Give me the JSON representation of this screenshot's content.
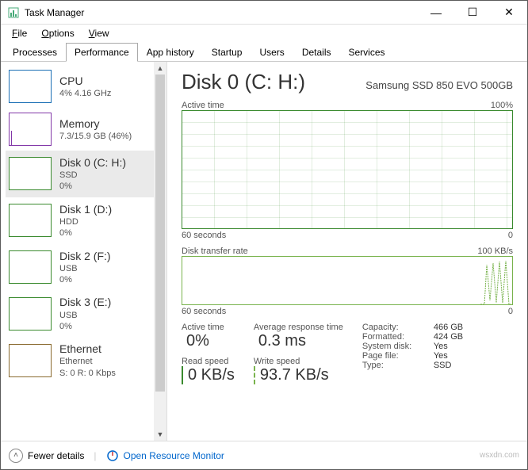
{
  "window": {
    "title": "Task Manager"
  },
  "menu": {
    "file": "File",
    "options": "Options",
    "view": "View"
  },
  "tabs": {
    "processes": "Processes",
    "performance": "Performance",
    "app_history": "App history",
    "startup": "Startup",
    "users": "Users",
    "details": "Details",
    "services": "Services"
  },
  "sidebar": {
    "items": [
      {
        "name": "CPU",
        "sub": "4% 4.16 GHz"
      },
      {
        "name": "Memory",
        "sub": "7.3/15.9 GB (46%)"
      },
      {
        "name": "Disk 0 (C: H:)",
        "sub": "SSD",
        "sub2": "0%"
      },
      {
        "name": "Disk 1 (D:)",
        "sub": "HDD",
        "sub2": "0%"
      },
      {
        "name": "Disk 2 (F:)",
        "sub": "USB",
        "sub2": "0%"
      },
      {
        "name": "Disk 3 (E:)",
        "sub": "USB",
        "sub2": "0%"
      },
      {
        "name": "Ethernet",
        "sub": "Ethernet",
        "sub2": "S: 0 R: 0 Kbps"
      }
    ]
  },
  "main": {
    "title": "Disk 0 (C: H:)",
    "model": "Samsung SSD 850 EVO 500GB",
    "chart1": {
      "label": "Active time",
      "max": "100%",
      "xaxis_left": "60 seconds",
      "xaxis_right": "0"
    },
    "chart2": {
      "label": "Disk transfer rate",
      "max": "100 KB/s",
      "xaxis_left": "60 seconds",
      "xaxis_right": "0"
    },
    "stats": {
      "active_time_lbl": "Active time",
      "active_time_val": "0%",
      "avg_resp_lbl": "Average response time",
      "avg_resp_val": "0.3 ms",
      "read_lbl": "Read speed",
      "read_val": "0 KB/s",
      "write_lbl": "Write speed",
      "write_val": "93.7 KB/s"
    },
    "kv": {
      "capacity_k": "Capacity:",
      "capacity_v": "466 GB",
      "formatted_k": "Formatted:",
      "formatted_v": "424 GB",
      "sysdisk_k": "System disk:",
      "sysdisk_v": "Yes",
      "pagefile_k": "Page file:",
      "pagefile_v": "Yes",
      "type_k": "Type:",
      "type_v": "SSD"
    }
  },
  "footer": {
    "fewer": "Fewer details",
    "resmon": "Open Resource Monitor"
  },
  "watermark": "wsxdn.com",
  "chart_data": [
    {
      "type": "line",
      "title": "Active time",
      "ylabel": "%",
      "ylim": [
        0,
        100
      ],
      "xlabel": "seconds",
      "xlim": [
        60,
        0
      ],
      "series": [
        {
          "name": "Active time",
          "values": [
            0,
            0,
            0,
            0,
            0,
            0,
            0,
            0,
            0,
            0,
            0,
            0,
            0,
            0,
            0,
            0,
            0,
            0,
            0,
            0,
            0,
            0,
            0,
            0,
            0,
            0,
            0,
            0,
            0,
            0,
            0,
            0,
            0,
            0,
            0,
            0,
            0,
            0,
            0,
            0,
            0,
            0,
            0,
            0,
            0,
            0,
            0,
            0,
            0,
            0,
            0,
            0,
            0,
            0,
            0,
            0,
            0,
            0,
            0,
            0
          ]
        }
      ]
    },
    {
      "type": "line",
      "title": "Disk transfer rate",
      "ylabel": "KB/s",
      "ylim": [
        0,
        100
      ],
      "xlabel": "seconds",
      "xlim": [
        60,
        0
      ],
      "series": [
        {
          "name": "Read speed",
          "values": [
            0,
            0,
            0,
            0,
            0,
            0,
            0,
            0,
            0,
            0,
            0,
            0,
            0,
            0,
            0,
            0,
            0,
            0,
            0,
            0,
            0,
            0,
            0,
            0,
            0,
            0,
            0,
            0,
            0,
            0,
            0,
            0,
            0,
            0,
            0,
            0,
            0,
            0,
            0,
            0,
            0,
            0,
            0,
            0,
            0,
            0,
            0,
            0,
            0,
            0,
            0,
            0,
            0,
            0,
            0,
            0,
            0,
            0,
            0,
            0
          ]
        },
        {
          "name": "Write speed",
          "values": [
            0,
            0,
            0,
            0,
            0,
            0,
            0,
            0,
            0,
            0,
            0,
            0,
            0,
            0,
            0,
            0,
            0,
            0,
            0,
            0,
            0,
            0,
            0,
            0,
            0,
            0,
            0,
            0,
            0,
            0,
            0,
            0,
            0,
            0,
            0,
            0,
            0,
            0,
            0,
            0,
            0,
            0,
            0,
            0,
            0,
            0,
            0,
            0,
            0,
            0,
            0,
            0,
            0,
            0,
            0,
            85,
            15,
            90,
            10,
            95
          ]
        }
      ]
    }
  ]
}
